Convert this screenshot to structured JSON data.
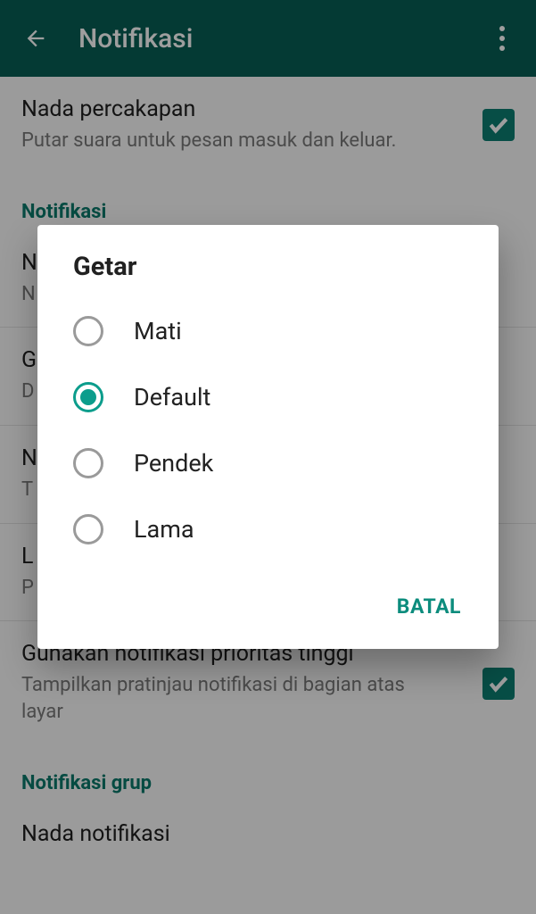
{
  "appbar": {
    "title": "Notifikasi"
  },
  "settings": {
    "conversation_tone": {
      "title": "Nada percakapan",
      "sub": "Putar suara untuk pesan masuk dan keluar."
    },
    "section_notif": "Notifikasi",
    "notif_tone": {
      "title": "N",
      "sub": "N"
    },
    "vibrate_item": {
      "title": "G",
      "sub": "D"
    },
    "popup": {
      "title": "N",
      "sub": "T"
    },
    "light": {
      "title": "L",
      "sub": "P"
    },
    "high_priority": {
      "title": "Gunakan notifikasi prioritas tinggi",
      "sub": "Tampilkan pratinjau notifikasi di bagian atas layar"
    },
    "section_group": "Notifikasi grup",
    "group_tone": {
      "title": "Nada notifikasi"
    }
  },
  "dialog": {
    "title": "Getar",
    "options": [
      "Mati",
      "Default",
      "Pendek",
      "Lama"
    ],
    "selected_index": 1,
    "cancel": "BATAL"
  }
}
